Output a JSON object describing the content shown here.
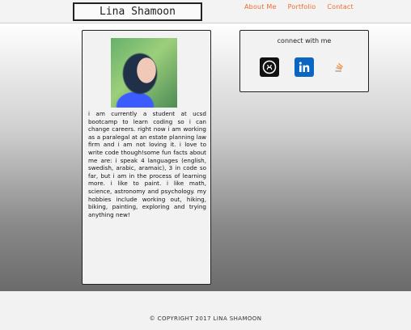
{
  "header": {
    "logo_text": "Lina Shamoon",
    "nav": [
      "About Me",
      "Portfolio",
      "Contact"
    ]
  },
  "about": {
    "bio": "I am currently a student at UCSD bootcamp to learn coding so I can change careers. Right now I am working as a paralegal at an estate planning law firm and I am not loving it. I love to write code though!Some fun facts about me are: I speak 4 languages (English, Swedish, Arabic, Aramaic), 3 in code so far, but I am in the process of learning more. I like to paint. I like math, science, astronomy and psychology. My hobbies include working out, hiking, biking, painting, exploring and trying anything new!"
  },
  "connect": {
    "title": "Connect with me",
    "icons": [
      "github-icon",
      "linkedin-icon",
      "stackoverflow-icon"
    ]
  },
  "footer": {
    "text": "© Copyright 2017 Lina Shamoon"
  },
  "colors": {
    "accent": "#f06a2e",
    "linkedin": "#0b66c2"
  }
}
